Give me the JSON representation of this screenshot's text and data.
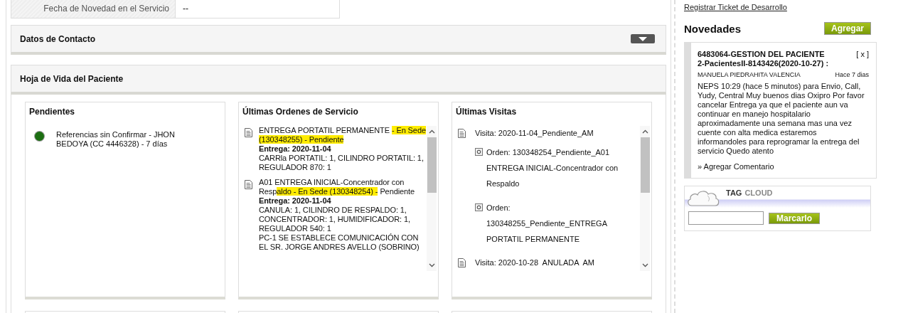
{
  "service_field": {
    "label": "Fecha de Novedad en el Servicio",
    "value": "--"
  },
  "sections": [
    {
      "title": "Datos de Contacto",
      "kind": "collapsible"
    },
    {
      "title": "Hoja de Vida del Paciente",
      "kind": "open"
    }
  ],
  "pendientes": {
    "title": "Pendientes",
    "items": [
      {
        "text": "Referencias sin Confirmar - JHON BEDOYA (CC 4446328) - 7 días",
        "color": "#1c6e12"
      }
    ]
  },
  "ordenes": {
    "title": "Últimas Ordenes de Servicio",
    "items": [
      {
        "segments": [
          {
            "text": "ENTREGA PORTATIL PERMANENTE ",
            "highlighted": false
          },
          {
            "text": "- En Sede (130348255) - Pendiente",
            "highlighted": true
          }
        ],
        "delivery": "Entrega: 2020-11-04",
        "details": [
          "CARRla PORTATIL: 1, CILINDRO PORTATIL: 1, REGULADOR 870: 1"
        ]
      },
      {
        "segments": [
          {
            "text": "A01 ENTREGA INICIAL-Concentrador con Resp",
            "highlighted": false
          },
          {
            "text": "aldo - En Sede (130348254) -",
            "highlighted": true
          },
          {
            "text": " Pendiente",
            "highlighted": false
          }
        ],
        "delivery": "Entrega: 2020-11-04",
        "details": [
          "CANULA: 1, CILINDRO DE RESPALDO: 1, CONCENTRADOR: 1, HUMIDIFICADOR: 1, REGULADOR 540: 1",
          "PC-1 SE ESTABLECE COMUNICACIÓN CON EL SR. JORGE ANDRES AVELLO (SOBRINO)"
        ]
      }
    ]
  },
  "visitas": {
    "title": "Últimas Visitas",
    "items": [
      {
        "text": "Visita: 2020-11-04_Pendiente_AM",
        "children": [
          {
            "text": "Orden: 130348254_Pendiente_A01 ENTREGA INICIAL-Concentrador con Respaldo"
          },
          {
            "text": "Orden: 130348255_Pendiente_ENTREGA PORTATIL PERMANENTE"
          }
        ]
      },
      {
        "text": "Visita: 2020-10-28  ANULADA  AM"
      }
    ]
  },
  "sidebar": {
    "link": "Registrar Ticket de Desarrollo",
    "title": "Novedades",
    "add_button": "Agregar",
    "news": [
      {
        "title": "6483064-GESTION DEL PACIENTE 2-PacientesII-8143426(2020-10-27) :",
        "close": "[ x ]",
        "author": "MANUELA PIEDRAHITA VALENCIA",
        "time": "Hace 7 dias",
        "body": "NEPS 10:29 (hace 5 minutos) para Envio, Call, Yudy, Central Muy buenos dias Oxipro Por favor cancelar Entrega ya que el paciente aun va continuar en manejo hospitalario aproximadamente una semana mas una vez cuente con alta medica estaremos informandoles para reprogramar la entrega del servicio Quedo atento",
        "comment_link": "» Agregar Comentario"
      }
    ],
    "tag_cloud": {
      "title_1": "TAG",
      "title_2": "CLOUD",
      "button": "Marcarlo"
    }
  }
}
